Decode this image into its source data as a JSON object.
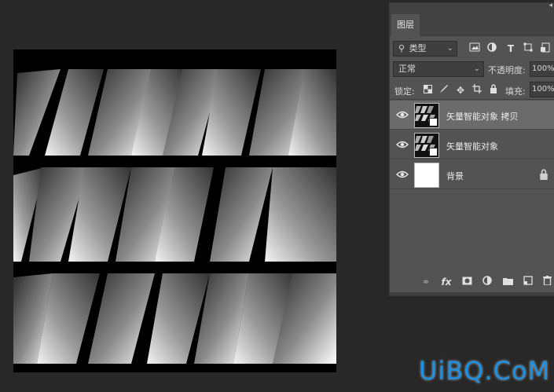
{
  "layers_panel": {
    "tab_label": "图层",
    "filter": {
      "value": "类型",
      "icons": [
        "image-filter-icon",
        "adjustment-filter-icon",
        "type-filter-icon",
        "shape-filter-icon",
        "smart-object-filter-icon"
      ],
      "type_glyph": "T"
    },
    "blend_mode": "正常",
    "opacity_label": "不透明度:",
    "opacity_value": "100%",
    "lock_label": "锁定:",
    "fill_label": "填充:",
    "fill_value": "100%",
    "layers": [
      {
        "name": "矢量智能对象 拷贝",
        "visible": true,
        "selected": true,
        "type": "smart-object"
      },
      {
        "name": "矢量智能对象",
        "visible": true,
        "selected": false,
        "type": "smart-object"
      },
      {
        "name": "背景",
        "visible": true,
        "selected": false,
        "type": "background",
        "locked": true
      }
    ],
    "bottom_icons": [
      "link-icon",
      "fx-icon",
      "mask-icon",
      "adjustment-icon",
      "folder-icon",
      "new-layer-icon",
      "trash-icon"
    ],
    "fx_label": "fx"
  },
  "watermark": "UiBQ.CoM",
  "colors": {
    "workspace": "#282828",
    "panel": "#535353",
    "selected_layer": "#6b6b6b",
    "watermark": "#1d8fe0"
  }
}
